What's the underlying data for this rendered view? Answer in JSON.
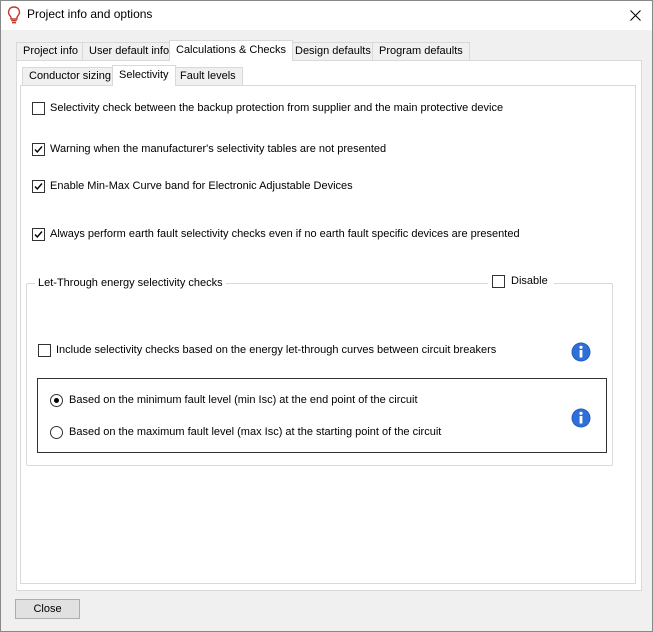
{
  "window": {
    "title": "Project info and options",
    "icon": "lightbulb-icon"
  },
  "tabs": [
    {
      "label": "Project info",
      "active": false
    },
    {
      "label": "User default info",
      "active": false
    },
    {
      "label": "Calculations & Checks",
      "active": true
    },
    {
      "label": "Design defaults",
      "active": false
    },
    {
      "label": "Program defaults",
      "active": false
    }
  ],
  "subtabs": [
    {
      "label": "Conductor sizing",
      "active": false
    },
    {
      "label": "Selectivity",
      "active": true
    },
    {
      "label": "Fault levels",
      "active": false
    }
  ],
  "options": [
    {
      "label": "Selectivity check between the backup protection from supplier and the main protective device",
      "checked": false
    },
    {
      "label": "Warning when the manufacturer's selectivity tables are not presented",
      "checked": true
    },
    {
      "label": "Enable Min-Max Curve band for Electronic Adjustable Devices",
      "checked": true
    },
    {
      "label": "Always perform earth fault selectivity checks even if no earth fault specific devices are presented",
      "checked": true
    }
  ],
  "letthrough": {
    "title": "Let-Through energy selectivity checks",
    "disable_label": "Disable",
    "disable_checked": false,
    "include_label": "Include selectivity checks based on the energy let-through curves between circuit breakers",
    "include_checked": false,
    "radio_min_label": "Based on the minimum fault level (min Isc) at the end point of the circuit",
    "radio_max_label": "Based on the maximum fault level (max Isc) at the starting point of the circuit",
    "selected": "min"
  },
  "buttons": {
    "close_label": "Close"
  },
  "colors": {
    "info_blue": "#1f5fc2",
    "lightbulb_red": "#c0392b"
  }
}
